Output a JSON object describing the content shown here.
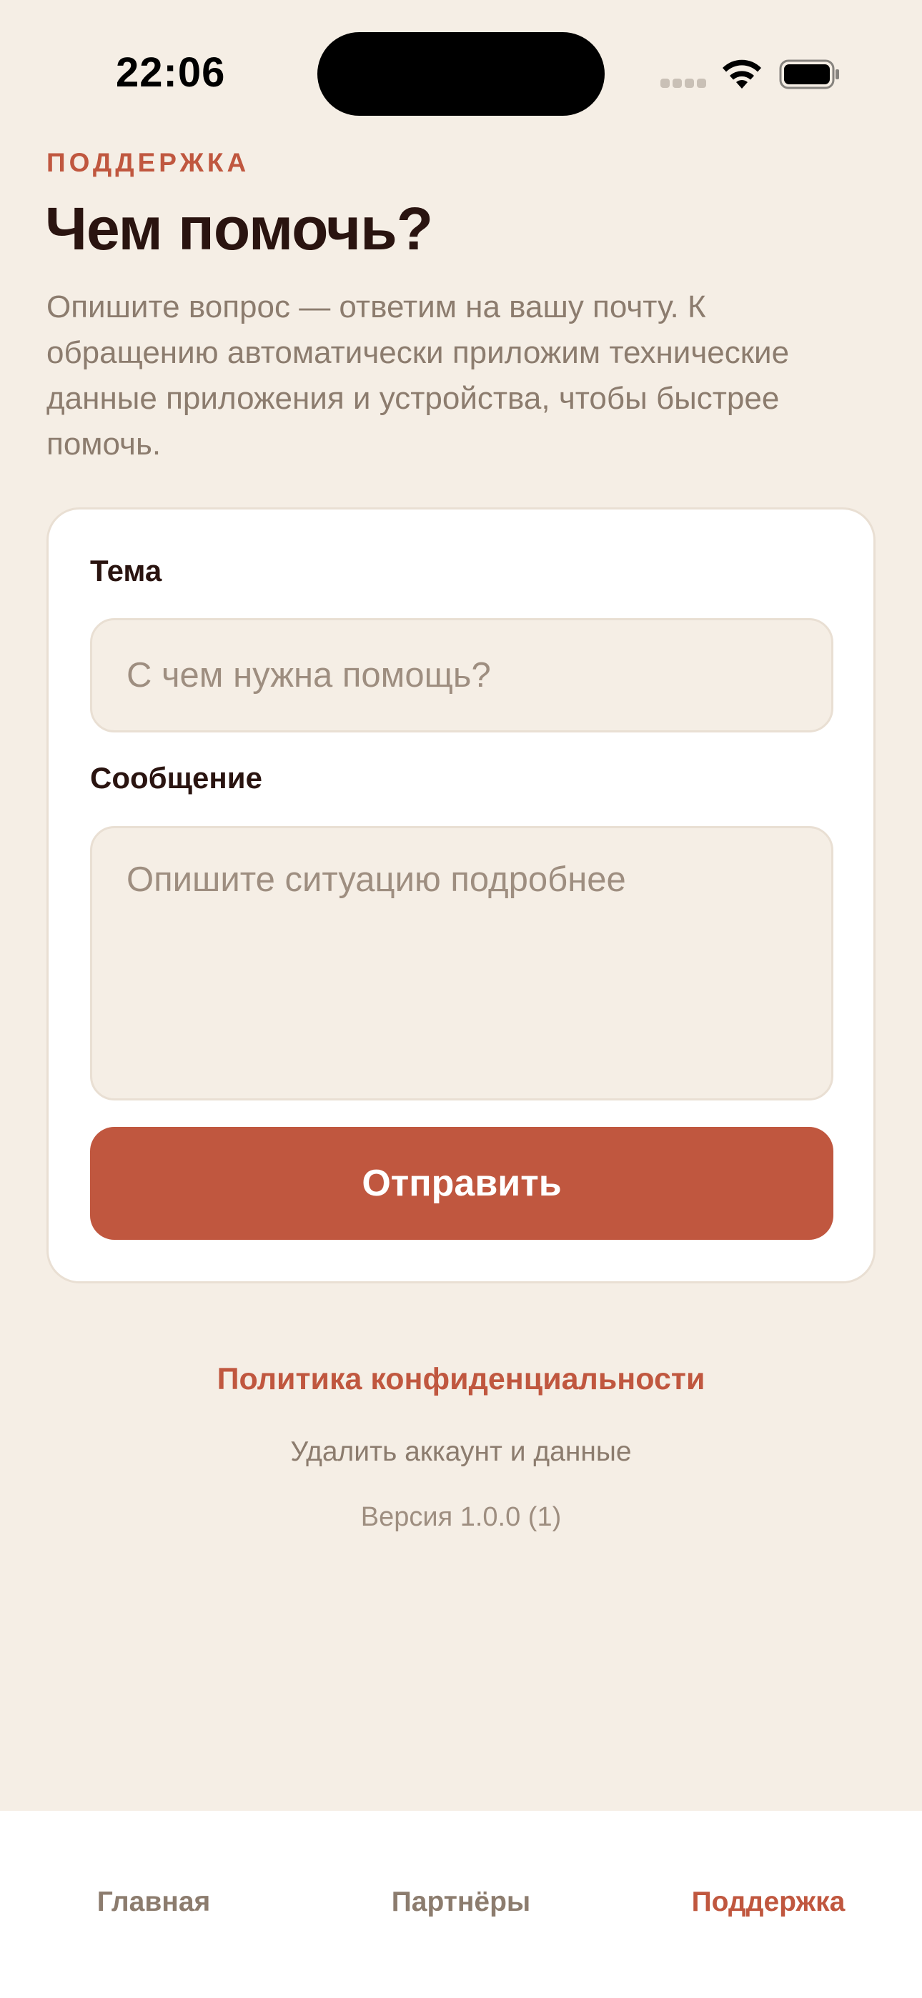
{
  "status_bar": {
    "time": "22:06",
    "icons": [
      "cellular-signal-icon",
      "wifi-icon",
      "battery-icon"
    ]
  },
  "header": {
    "eyebrow": "ПОДДЕРЖКА",
    "title": "Чем помочь?",
    "description": "Опишите вопрос — ответим на вашу почту. К обращению автоматически приложим технические данные приложения и устройства, чтобы быстрее помочь."
  },
  "form": {
    "subject_label": "Тема",
    "subject_placeholder": "С чем нужна помощь?",
    "subject_value": "",
    "message_label": "Сообщение",
    "message_placeholder": "Опишите ситуацию подробнее",
    "message_value": "",
    "submit_label": "Отправить"
  },
  "footer": {
    "privacy_link": "Политика конфиденциальности",
    "delete_account_link": "Удалить аккаунт и данные",
    "version": "Версия 1.0.0 (1)"
  },
  "tab_bar": {
    "tabs": [
      {
        "label": "Главная",
        "active": false
      },
      {
        "label": "Партнёры",
        "active": false
      },
      {
        "label": "Поддержка",
        "active": true
      }
    ]
  },
  "colors": {
    "background": "#F5EEE5",
    "accent": "#C0573F",
    "text_primary": "#2A1410",
    "text_secondary": "#8C7C6E",
    "card": "#FFFFFF",
    "field_background": "#F5EEE5"
  }
}
